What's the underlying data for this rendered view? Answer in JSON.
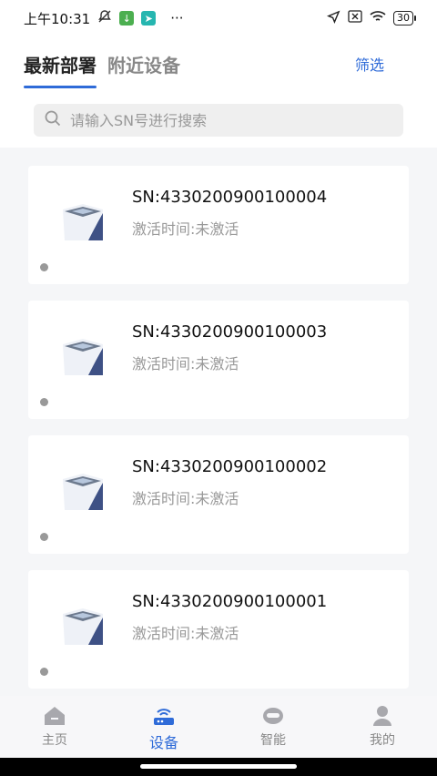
{
  "status_bar": {
    "time": "上午10:31",
    "more": "···",
    "battery": "30"
  },
  "header": {
    "tabs": [
      {
        "label": "最新部署"
      },
      {
        "label": "附近设备"
      }
    ],
    "filter_label": "筛选",
    "search_placeholder": "请输入SN号进行搜索"
  },
  "devices": [
    {
      "sn": "SN:4330200900100004",
      "activation": "激活时间:未激活"
    },
    {
      "sn": "SN:4330200900100003",
      "activation": "激活时间:未激活"
    },
    {
      "sn": "SN:4330200900100002",
      "activation": "激活时间:未激活"
    },
    {
      "sn": "SN:4330200900100001",
      "activation": "激活时间:未激活"
    }
  ],
  "bottom_nav": [
    {
      "label": "主页",
      "icon": "home-icon"
    },
    {
      "label": "设备",
      "icon": "router-icon"
    },
    {
      "label": "智能",
      "icon": "robot-icon"
    },
    {
      "label": "我的",
      "icon": "user-icon"
    }
  ],
  "colors": {
    "accent": "#2f6bd8",
    "muted": "#999999"
  }
}
